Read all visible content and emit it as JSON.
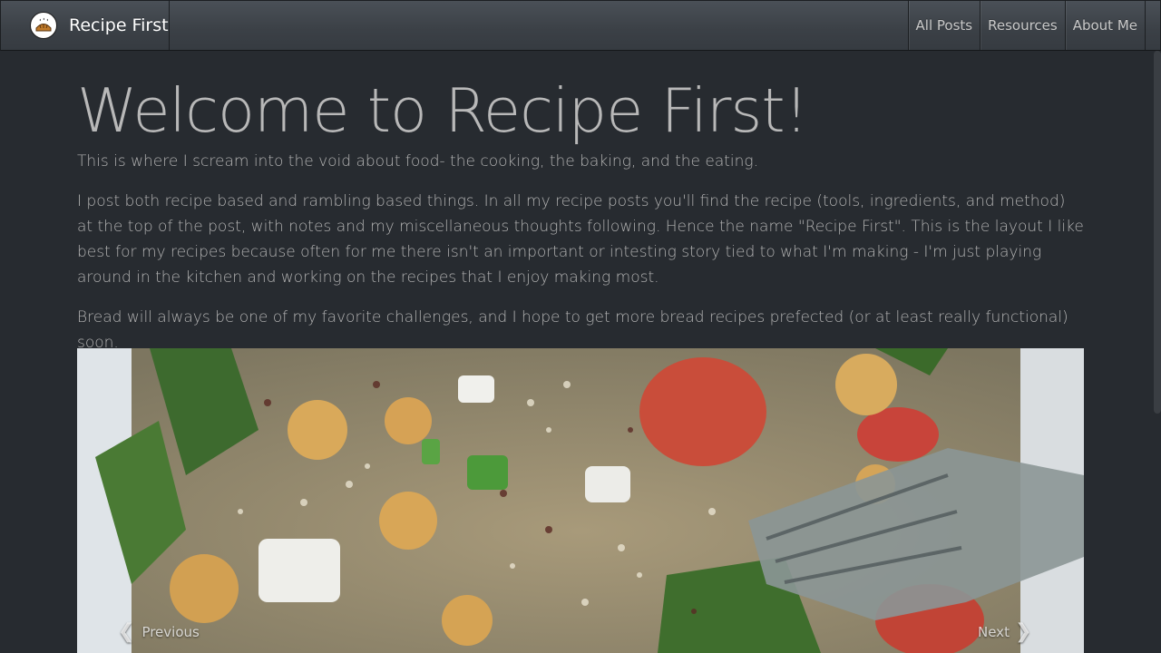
{
  "navbar": {
    "brand_title": "Recipe First",
    "links": [
      "All Posts",
      "Resources",
      "About Me"
    ]
  },
  "main": {
    "heading": "Welcome to Recipe First!",
    "lead": "This is where I scream into the void about food- the cooking, the baking, and the eating.",
    "paragraph_2": "I post both recipe based and rambling based things. In all my recipe posts you'll find the recipe (tools, ingredients, and method) at the top of the post, with notes and my miscellaneous thoughts following. Hence the name \"Recipe First\". This is the layout I like best for my recipes because often for me there isn't an important or intesting story tied to what I'm making - I'm just playing around in the kitchen and working on the recipes that I enjoy making most.",
    "paragraph_3": "Bread will always be one of my favorite challenges, and I hope to get more bread recipes prefected (or at least really functional) soon."
  },
  "carousel": {
    "prev_label": "Previous",
    "next_label": "Next",
    "prev_icon": "chevron-left-icon",
    "next_icon": "chevron-right-icon"
  },
  "colors": {
    "background": "#272b30",
    "navbar": "#3a3f44",
    "text": "#aaaaaa",
    "heading": "#b8b8b8"
  }
}
